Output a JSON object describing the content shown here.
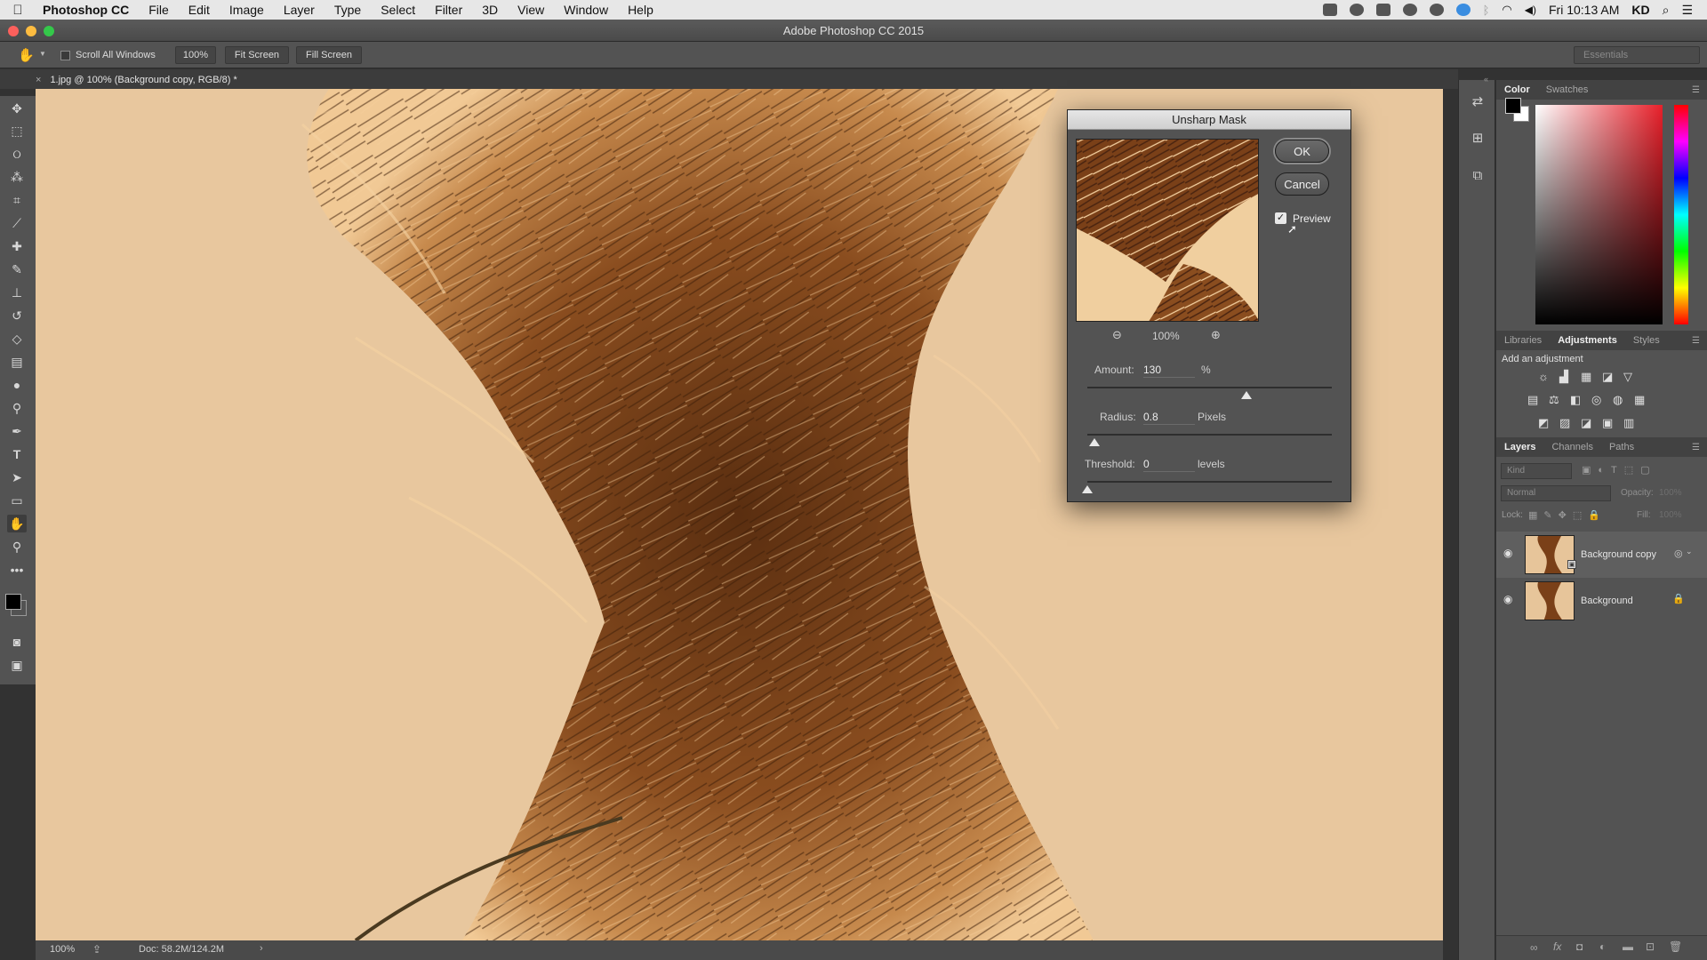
{
  "menubar": {
    "app_name": "Photoshop CC",
    "items": [
      "File",
      "Edit",
      "Image",
      "Layer",
      "Type",
      "Select",
      "Filter",
      "3D",
      "View",
      "Window",
      "Help"
    ],
    "clock": "Fri 10:13 AM",
    "user": "KD"
  },
  "window": {
    "title": "Adobe Photoshop CC 2015"
  },
  "options_bar": {
    "scroll_all_windows": "Scroll All Windows",
    "zoom_btn": "100%",
    "fit_screen": "Fit Screen",
    "fill_screen": "Fill Screen",
    "workspace": "Essentials"
  },
  "document": {
    "tab_title": "1.jpg @ 100% (Background copy, RGB/8) *",
    "close_glyph": "×"
  },
  "status_bar": {
    "zoom": "100%",
    "doc_size": "Doc: 58.2M/124.2M"
  },
  "dialog": {
    "title": "Unsharp Mask",
    "ok": "OK",
    "cancel": "Cancel",
    "preview_label": "Preview",
    "preview_checked": true,
    "preview_zoom": "100%",
    "amount_label": "Amount:",
    "amount_value": "130",
    "amount_unit": "%",
    "amount_slider_fraction": 0.65,
    "radius_label": "Radius:",
    "radius_value": "0.8",
    "radius_unit": "Pixels",
    "radius_slider_fraction": 0.03,
    "threshold_label": "Threshold:",
    "threshold_value": "0",
    "threshold_unit": "levels",
    "threshold_slider_fraction": 0.0
  },
  "color_panel": {
    "tabs": [
      "Color",
      "Swatches"
    ],
    "active_tab": "Color",
    "foreground": "#000000",
    "background": "#ffffff",
    "hue_color": "#e8202a"
  },
  "adjustments_panel": {
    "tabs": [
      "Libraries",
      "Adjustments",
      "Styles"
    ],
    "active_tab": "Adjustments",
    "heading": "Add an adjustment"
  },
  "layers_panel": {
    "tabs": [
      "Layers",
      "Channels",
      "Paths"
    ],
    "active_tab": "Layers",
    "kind_placeholder": "Kind",
    "blend_mode": "Normal",
    "opacity_label": "Opacity:",
    "opacity_value": "100%",
    "lock_label": "Lock:",
    "fill_label": "Fill:",
    "fill_value": "100%",
    "layers": [
      {
        "name": "Background copy",
        "selected": true
      },
      {
        "name": "Background",
        "selected": false
      }
    ]
  },
  "colors": {
    "canvas_bg": "#e8c79e",
    "plume_dark": "#5a2e10",
    "plume_mid": "#9a5a24",
    "plume_light": "#f6d3a3",
    "ui_panel": "#535353",
    "traffic_red": "#fc605c",
    "traffic_yellow": "#fdbc40",
    "traffic_green": "#34c84a"
  }
}
